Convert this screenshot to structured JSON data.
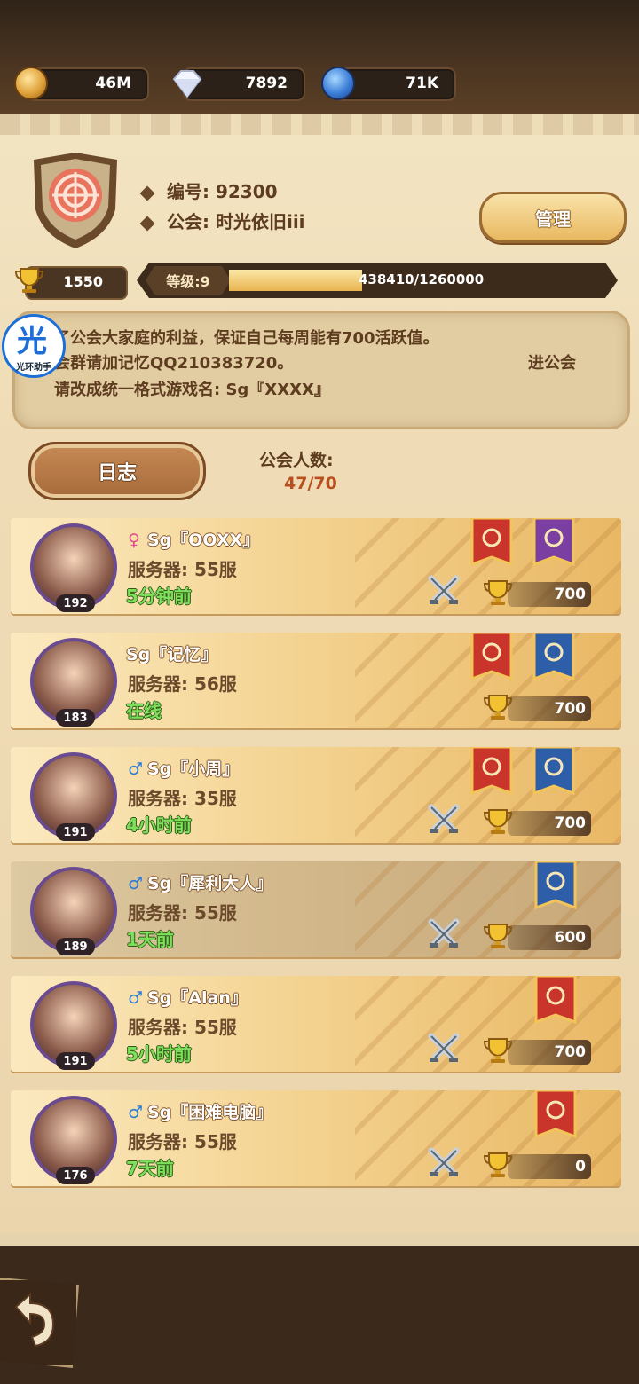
{
  "resources": [
    {
      "icon": "gold-coin-icon",
      "value": "46M"
    },
    {
      "icon": "diamond-icon",
      "value": "7892"
    },
    {
      "icon": "blue-crystal-icon",
      "value": "71K"
    }
  ],
  "guild": {
    "id_label": "编号: 92300",
    "name_label": "公会: 时光依旧iii",
    "manage_label": "管理",
    "trophies": "1550",
    "level_label": "等级:9",
    "exp_text": "438410/1260000",
    "exp_progress": 0.348
  },
  "notice": {
    "lines": [
      "了公会大家庭的利益，保证自己每周能有700活跃值。",
      "会群请加记忆QQ210383720。",
      "请改成统一格式游戏名: Sg『XXXX』"
    ],
    "line2_suffix": "进公会"
  },
  "assistant_badge": {
    "big": "光",
    "small": "光环助手"
  },
  "log_button": "日志",
  "members": {
    "label": "公会人数:",
    "count": "47/70"
  },
  "member_rows": [
    {
      "gender": "female",
      "gender_symbol": "♀",
      "name": "Sg『OOXX』",
      "server": "服务器: 55服",
      "status": "5分钟前",
      "level": "192",
      "points": "700",
      "banners": [
        "red",
        "purple"
      ],
      "dim": false
    },
    {
      "gender": "none",
      "gender_symbol": "",
      "name": "Sg『记忆』",
      "server": "服务器: 56服",
      "status": "在线",
      "level": "183",
      "points": "700",
      "banners": [
        "red",
        "blue"
      ],
      "dim": false
    },
    {
      "gender": "male",
      "gender_symbol": "♂",
      "name": "Sg『小周』",
      "server": "服务器: 35服",
      "status": "4小时前",
      "level": "191",
      "points": "700",
      "banners": [
        "red",
        "blue"
      ],
      "dim": false
    },
    {
      "gender": "male",
      "gender_symbol": "♂",
      "name": "Sg『犀利大人』",
      "server": "服务器: 55服",
      "status": "1天前",
      "level": "189",
      "points": "600",
      "banners": [
        "blue"
      ],
      "dim": true
    },
    {
      "gender": "male",
      "gender_symbol": "♂",
      "name": "Sg『Alan』",
      "server": "服务器: 55服",
      "status": "5小时前",
      "level": "191",
      "points": "700",
      "banners": [
        "red"
      ],
      "dim": false
    },
    {
      "gender": "male",
      "gender_symbol": "♂",
      "name": "Sg『困难电脑』",
      "server": "服务器: 55服",
      "status": "7天前",
      "level": "176",
      "points": "0",
      "banners": [
        "red"
      ],
      "dim": false
    }
  ],
  "colors": {
    "banner_red": "#c9352a",
    "banner_blue": "#2f5ea8",
    "banner_purple": "#7a3fa0",
    "status_green": "#7ee05a",
    "female": "#e0508a",
    "male": "#2c7bd6"
  }
}
